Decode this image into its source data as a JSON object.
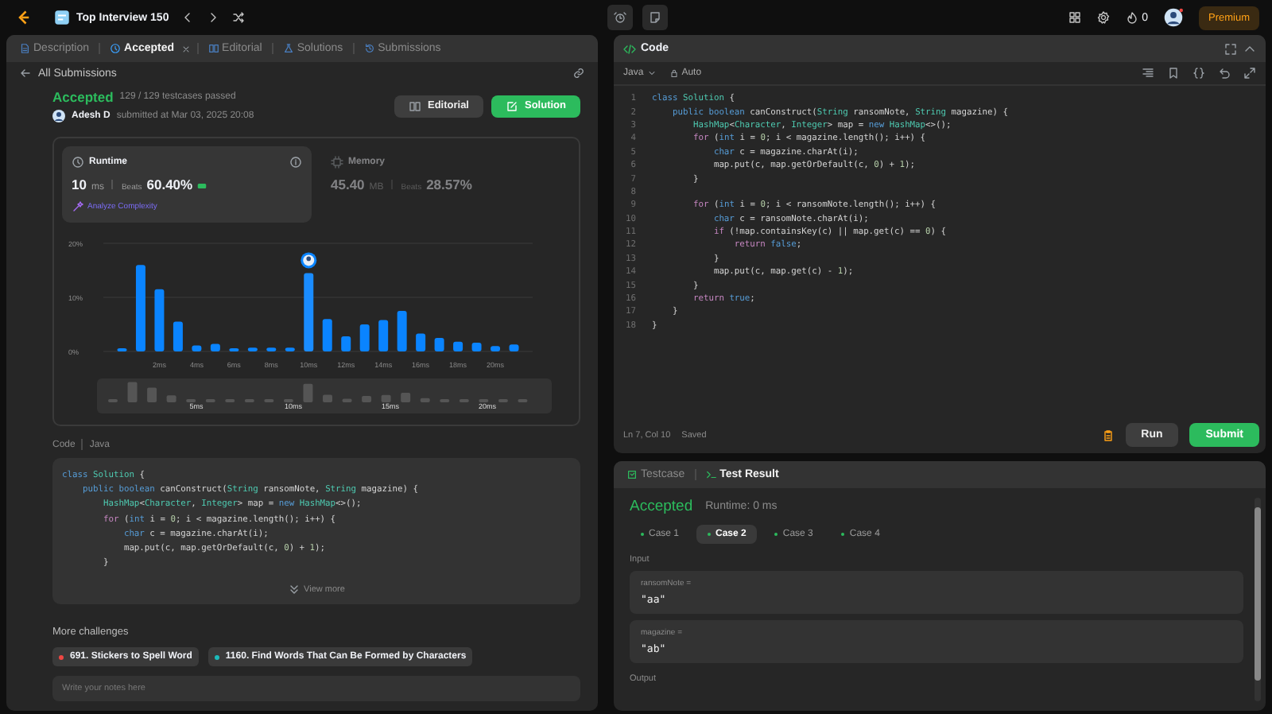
{
  "topbar": {
    "title": "Top Interview 150",
    "coins": "0",
    "premium": "Premium"
  },
  "left_tabs": [
    {
      "label": "Description",
      "selected": false,
      "closable": false,
      "kind": "doc"
    },
    {
      "label": "Accepted",
      "selected": true,
      "closable": true,
      "kind": "clock"
    },
    {
      "label": "Editorial",
      "selected": false,
      "closable": false,
      "kind": "book"
    },
    {
      "label": "Solutions",
      "selected": false,
      "closable": false,
      "kind": "flask"
    },
    {
      "label": "Submissions",
      "selected": false,
      "closable": false,
      "kind": "history"
    }
  ],
  "back_link": "All Submissions",
  "submission": {
    "status": "Accepted",
    "testcases": "129 / 129 testcases passed",
    "user": "Adesh D",
    "submitted": "submitted at Mar 03, 2025 20:08",
    "editorial_button": "Editorial",
    "solution_button": "Solution"
  },
  "runtime": {
    "label": "Runtime",
    "value": "10",
    "unit": "ms",
    "beats_label": "Beats",
    "beats": "60.40%",
    "analyze": "Analyze Complexity",
    "selected": true
  },
  "memory": {
    "label": "Memory",
    "value": "45.40",
    "unit": "MB",
    "beats_label": "Beats",
    "beats": "28.57%",
    "selected": false
  },
  "chart_data": {
    "type": "bar",
    "x": [
      0,
      1,
      2,
      3,
      4,
      5,
      6,
      7,
      8,
      9,
      10,
      11,
      12,
      13,
      14,
      15,
      16,
      17,
      18,
      19,
      20,
      21
    ],
    "values": [
      0.6,
      16,
      11.5,
      5.5,
      1.1,
      1.4,
      0.6,
      0.7,
      0.7,
      0.7,
      14.5,
      6,
      2.8,
      5,
      5.8,
      7.5,
      3.3,
      2.5,
      1.8,
      1.6,
      1,
      1.3
    ],
    "xlim": [
      -1,
      22
    ],
    "ylim": [
      0,
      20
    ],
    "yticks": [
      {
        "value": 0,
        "label": "0%"
      },
      {
        "value": 10,
        "label": "10%"
      },
      {
        "value": 20,
        "label": "20%"
      }
    ],
    "xticks": [
      {
        "value": 2,
        "label": "2ms"
      },
      {
        "value": 4,
        "label": "4ms"
      },
      {
        "value": 6,
        "label": "6ms"
      },
      {
        "value": 8,
        "label": "8ms"
      },
      {
        "value": 10,
        "label": "10ms"
      },
      {
        "value": 12,
        "label": "12ms"
      },
      {
        "value": 14,
        "label": "14ms"
      },
      {
        "value": 16,
        "label": "16ms"
      },
      {
        "value": 18,
        "label": "18ms"
      },
      {
        "value": 20,
        "label": "20ms"
      }
    ],
    "data_labels": false
  },
  "chart_bars": [
    {
      "selected": false
    },
    {
      "selected": false
    },
    {
      "selected": false
    },
    {
      "selected": false
    },
    {
      "selected": false
    },
    {
      "selected": false
    },
    {
      "selected": false
    },
    {
      "selected": false
    },
    {
      "selected": false
    },
    {
      "selected": false
    },
    {
      "selected": true
    },
    {
      "selected": false
    },
    {
      "selected": false
    },
    {
      "selected": false
    },
    {
      "selected": false
    },
    {
      "selected": false
    },
    {
      "selected": false
    },
    {
      "selected": false
    },
    {
      "selected": false
    },
    {
      "selected": false
    },
    {
      "selected": false
    },
    {
      "selected": false
    }
  ],
  "overview_labels": [
    "5ms",
    "10ms",
    "15ms",
    "20ms"
  ],
  "code_preview": {
    "label": "Code",
    "language": "Java",
    "view_more": "View more",
    "lines": [
      [
        {
          "kind": "kw",
          "text": "class "
        },
        {
          "kind": "type",
          "text": "Solution"
        },
        {
          "kind": "p",
          "text": " {"
        }
      ],
      [
        {
          "kind": "kw",
          "text": "    public boolean "
        },
        {
          "kind": "p",
          "text": "canConstruct("
        },
        {
          "kind": "type",
          "text": "String"
        },
        {
          "kind": "p",
          "text": " ransomNote, "
        },
        {
          "kind": "type",
          "text": "String"
        },
        {
          "kind": "p",
          "text": " magazine) {"
        }
      ],
      [
        {
          "kind": "type",
          "text": "        HashMap"
        },
        {
          "kind": "p",
          "text": "<"
        },
        {
          "kind": "type",
          "text": "Character"
        },
        {
          "kind": "p",
          "text": ", "
        },
        {
          "kind": "type",
          "text": "Integer"
        },
        {
          "kind": "p",
          "text": "> map = "
        },
        {
          "kind": "kw",
          "text": "new "
        },
        {
          "kind": "type",
          "text": "HashMap"
        },
        {
          "kind": "p",
          "text": "<>();"
        }
      ],
      [
        {
          "kind": "ctl",
          "text": "        for"
        },
        {
          "kind": "p",
          "text": " ("
        },
        {
          "kind": "kw",
          "text": "int"
        },
        {
          "kind": "p",
          "text": " i = "
        },
        {
          "kind": "num",
          "text": "0"
        },
        {
          "kind": "p",
          "text": "; i < magazine.length(); i++) {"
        }
      ],
      [
        {
          "kind": "kw",
          "text": "            char"
        },
        {
          "kind": "p",
          "text": " c = magazine.charAt(i);"
        }
      ],
      [
        {
          "kind": "p",
          "text": "            map.put(c, map.getOrDefault(c, "
        },
        {
          "kind": "num",
          "text": "0"
        },
        {
          "kind": "p",
          "text": ") + "
        },
        {
          "kind": "num",
          "text": "1"
        },
        {
          "kind": "p",
          "text": ");"
        }
      ],
      [
        {
          "kind": "p",
          "text": "        }"
        }
      ]
    ]
  },
  "more_challenges": {
    "title": "More challenges",
    "items": [
      {
        "label": "691. Stickers to Spell Word",
        "color": "#ef4743"
      },
      {
        "label": "1160. Find Words That Can Be Formed by Characters",
        "color": "#1cbaba"
      }
    ]
  },
  "notes": {
    "placeholder": "Write your notes here"
  },
  "editor": {
    "title": "Code",
    "language": "Java",
    "mode": "Auto",
    "status": "Ln 7, Col 10",
    "saved": "Saved",
    "run": "Run",
    "submit": "Submit",
    "lines": [
      {
        "n": "1",
        "tokens": [
          {
            "kind": "kw",
            "text": "class "
          },
          {
            "kind": "type",
            "text": "Solution"
          },
          {
            "kind": "p",
            "text": " {"
          }
        ]
      },
      {
        "n": "2",
        "tokens": [
          {
            "kind": "kw",
            "text": "    public boolean "
          },
          {
            "kind": "p",
            "text": "canConstruct("
          },
          {
            "kind": "type",
            "text": "String"
          },
          {
            "kind": "p",
            "text": " ransomNote, "
          },
          {
            "kind": "type",
            "text": "String"
          },
          {
            "kind": "p",
            "text": " magazine) {"
          }
        ]
      },
      {
        "n": "3",
        "tokens": [
          {
            "kind": "type",
            "text": "        HashMap"
          },
          {
            "kind": "p",
            "text": "<"
          },
          {
            "kind": "type",
            "text": "Character"
          },
          {
            "kind": "p",
            "text": ", "
          },
          {
            "kind": "type",
            "text": "Integer"
          },
          {
            "kind": "p",
            "text": "> map = "
          },
          {
            "kind": "kw",
            "text": "new "
          },
          {
            "kind": "type",
            "text": "HashMap"
          },
          {
            "kind": "p",
            "text": "<>();"
          }
        ]
      },
      {
        "n": "4",
        "tokens": [
          {
            "kind": "ctl",
            "text": "        for"
          },
          {
            "kind": "p",
            "text": " ("
          },
          {
            "kind": "kw",
            "text": "int"
          },
          {
            "kind": "p",
            "text": " i = "
          },
          {
            "kind": "num",
            "text": "0"
          },
          {
            "kind": "p",
            "text": "; i < magazine.length(); i++) {"
          }
        ]
      },
      {
        "n": "5",
        "tokens": [
          {
            "kind": "kw",
            "text": "            char"
          },
          {
            "kind": "p",
            "text": " c = magazine.charAt(i);"
          }
        ]
      },
      {
        "n": "6",
        "tokens": [
          {
            "kind": "p",
            "text": "            map.put(c, map.getOrDefault(c, "
          },
          {
            "kind": "num",
            "text": "0"
          },
          {
            "kind": "p",
            "text": ") + "
          },
          {
            "kind": "num",
            "text": "1"
          },
          {
            "kind": "p",
            "text": ");"
          }
        ]
      },
      {
        "n": "7",
        "tokens": [
          {
            "kind": "p",
            "text": "        }"
          }
        ]
      },
      {
        "n": "8"
      },
      {
        "n": "9",
        "tokens": [
          {
            "kind": "ctl",
            "text": "        for"
          },
          {
            "kind": "p",
            "text": " ("
          },
          {
            "kind": "kw",
            "text": "int"
          },
          {
            "kind": "p",
            "text": " i = "
          },
          {
            "kind": "num",
            "text": "0"
          },
          {
            "kind": "p",
            "text": "; i < ransomNote.length(); i++) {"
          }
        ]
      },
      {
        "n": "10",
        "tokens": [
          {
            "kind": "kw",
            "text": "            char"
          },
          {
            "kind": "p",
            "text": " c = ransomNote.charAt(i);"
          }
        ]
      },
      {
        "n": "11",
        "tokens": [
          {
            "kind": "ctl",
            "text": "            if"
          },
          {
            "kind": "p",
            "text": " (!map.containsKey(c) || map.get(c) == "
          },
          {
            "kind": "num",
            "text": "0"
          },
          {
            "kind": "p",
            "text": ") {"
          }
        ]
      },
      {
        "n": "12",
        "tokens": [
          {
            "kind": "ctl",
            "text": "                return "
          },
          {
            "kind": "kw",
            "text": "false"
          },
          {
            "kind": "p",
            "text": ";"
          }
        ]
      },
      {
        "n": "13",
        "tokens": [
          {
            "kind": "p",
            "text": "            }"
          }
        ]
      },
      {
        "n": "14",
        "tokens": [
          {
            "kind": "p",
            "text": "            map.put(c, map.get(c) - "
          },
          {
            "kind": "num",
            "text": "1"
          },
          {
            "kind": "p",
            "text": ");"
          }
        ]
      },
      {
        "n": "15",
        "tokens": [
          {
            "kind": "p",
            "text": "        }"
          }
        ]
      },
      {
        "n": "16",
        "tokens": [
          {
            "kind": "ctl",
            "text": "        return "
          },
          {
            "kind": "kw",
            "text": "true"
          },
          {
            "kind": "p",
            "text": ";"
          }
        ]
      },
      {
        "n": "17",
        "tokens": [
          {
            "kind": "p",
            "text": "    }"
          }
        ]
      },
      {
        "n": "18",
        "tokens": [
          {
            "kind": "p",
            "text": "}"
          }
        ]
      }
    ]
  },
  "result": {
    "tabs": [
      {
        "label": "Testcase",
        "selected": false
      },
      {
        "label": "Test Result",
        "selected": true
      }
    ],
    "status": "Accepted",
    "runtime": "Runtime: 0 ms",
    "cases": [
      {
        "label": "Case 1",
        "selected": false
      },
      {
        "label": "Case 2",
        "selected": true
      },
      {
        "label": "Case 3",
        "selected": false
      },
      {
        "label": "Case 4",
        "selected": false
      }
    ],
    "input_label": "Input",
    "inputs": [
      {
        "name": "ransomNote =",
        "value": "\"aa\""
      },
      {
        "name": "magazine =",
        "value": "\"ab\""
      }
    ],
    "output_label": "Output"
  }
}
